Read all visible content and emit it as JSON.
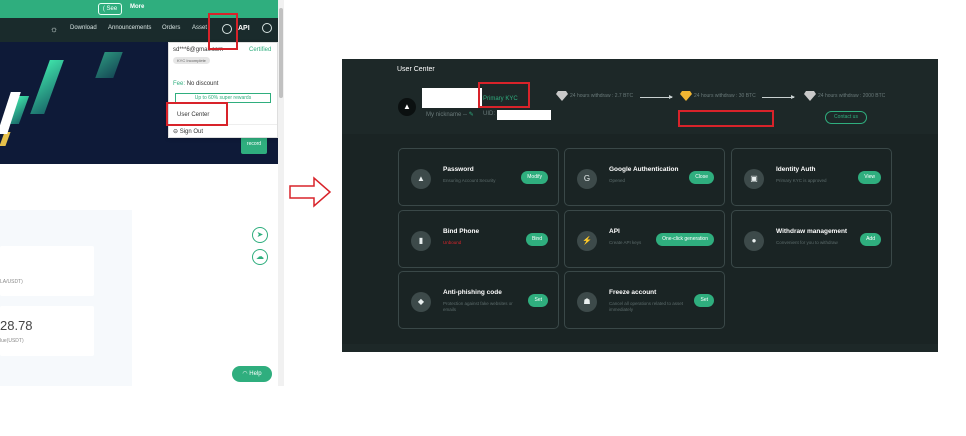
{
  "left": {
    "banner": {
      "see_label": "( See",
      "more_label": "More"
    },
    "nav": {
      "download": "Download",
      "announcements": "Announcements",
      "orders": "Orders",
      "assets": "Asset",
      "api": "API"
    },
    "dropdown": {
      "email": "sd***6@gmail.com",
      "certified": "Certified",
      "kyc_badge": "KYC Incomplete",
      "fee_prefix": "Fee:",
      "fee_value": "No discount",
      "promo_button": "Up to 60% super rewards",
      "user_center": "User Center",
      "sign_out": "Sign Out"
    },
    "hero_badge": "record",
    "balance_value": "28.78",
    "pair_hint_1": "LA/USDT)",
    "pair_hint_2": "lue(USDT)",
    "help_label": "Help"
  },
  "right": {
    "title": "User Center",
    "kyc_level": "Primary KYC",
    "nickname_label": "My nickname --",
    "uid_label": "UID:",
    "tiers": [
      {
        "label": "24 hours withdraw : 2.7 BTC",
        "color": "#c9c9c9"
      },
      {
        "label": "24 hours withdraw : 30 BTC",
        "color": "#f2b632"
      },
      {
        "label": "24 hours withdraw : 2000 BTC",
        "color": "#c9c9c9"
      }
    ],
    "contact_button": "Contact us",
    "tiles": [
      {
        "title": "Password",
        "desc": "Ensuring Account Security",
        "button": "Modify",
        "icon": "mountain-icon",
        "glyph": "▲",
        "alert": false
      },
      {
        "title": "Google Authentication",
        "desc": "Opened",
        "button": "Close",
        "icon": "google-icon",
        "glyph": "G",
        "alert": false
      },
      {
        "title": "Identity Auth",
        "desc": "Primary KYC is approved",
        "button": "View",
        "icon": "id-card-icon",
        "glyph": "▣",
        "alert": false
      },
      {
        "title": "Bind Phone",
        "desc": "Unbound",
        "button": "Bind",
        "icon": "phone-icon",
        "glyph": "▮",
        "alert": true
      },
      {
        "title": "API",
        "desc": "Create API keys",
        "button": "One-click generation",
        "icon": "plug-icon",
        "glyph": "⚡",
        "alert": false
      },
      {
        "title": "Withdraw management",
        "desc": "Convenient for you to withdraw",
        "button": "Add",
        "icon": "location-icon",
        "glyph": "●",
        "alert": false
      },
      {
        "title": "Anti-phishing code",
        "desc": "Protection against fake websites or emails",
        "button": "Set",
        "icon": "shield-icon",
        "glyph": "◆",
        "alert": false
      },
      {
        "title": "Freeze account",
        "desc": "Cancel all operations related to asset immediately",
        "button": "Set",
        "icon": "user-lock-icon",
        "glyph": "☗",
        "alert": false
      }
    ]
  }
}
